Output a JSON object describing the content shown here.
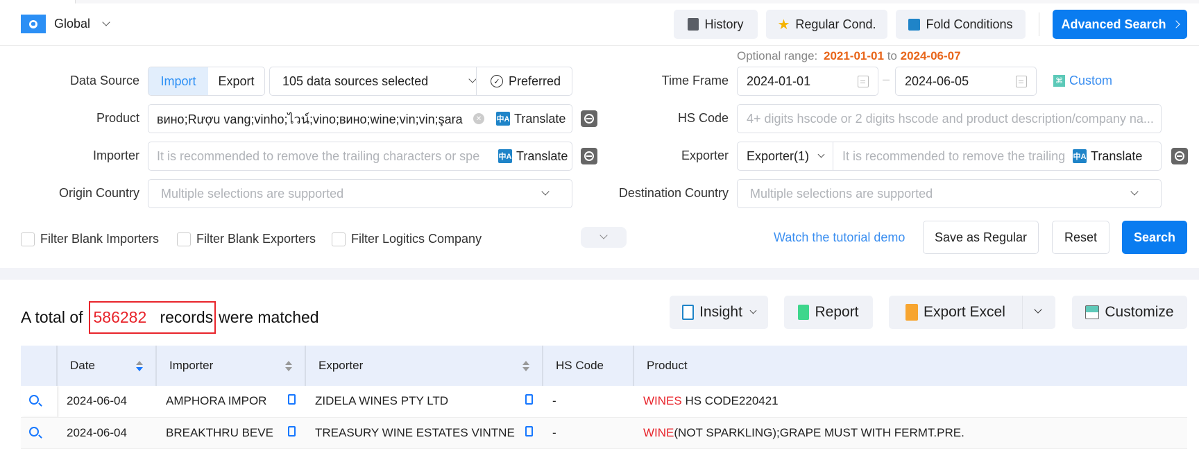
{
  "header": {
    "region": "Global",
    "buttons": {
      "history": "History",
      "regular_cond": "Regular Cond.",
      "fold_conditions": "Fold Conditions",
      "advanced_search": "Advanced Search"
    }
  },
  "form": {
    "data_source": {
      "label": "Data Source",
      "tabs": [
        "Import",
        "Export"
      ],
      "active_tab": "Import",
      "sources_selected": "105 data sources selected",
      "preferred": "Preferred"
    },
    "product": {
      "label": "Product",
      "value": "вино;Rượu vang;vinho;ไวน์;vino;вино;wine;vin;vin;şara",
      "translate": "Translate"
    },
    "importer": {
      "label": "Importer",
      "placeholder": "It is recommended to remove the trailing characters or spe",
      "translate": "Translate"
    },
    "origin_country": {
      "label": "Origin Country",
      "placeholder": "Multiple selections are supported"
    },
    "optional_range": {
      "label": "Optional range:",
      "from": "2021-01-01",
      "to_word": "to",
      "to": "2024-06-07"
    },
    "time_frame": {
      "label": "Time Frame",
      "start": "2024-01-01",
      "end": "2024-06-05",
      "separator": "–",
      "custom": "Custom"
    },
    "hs_code": {
      "label": "HS Code",
      "placeholder": "4+ digits hscode or 2 digits hscode and product description/company na..."
    },
    "exporter": {
      "label": "Exporter",
      "select": "Exporter(1)",
      "placeholder": "It is recommended to remove the trailing",
      "translate": "Translate"
    },
    "destination_country": {
      "label": "Destination Country",
      "placeholder": "Multiple selections are supported"
    },
    "filters": [
      "Filter Blank Importers",
      "Filter Blank Exporters",
      "Filter Logitics Company"
    ],
    "tutorial_link": "Watch the tutorial demo",
    "save_regular": "Save as Regular",
    "reset": "Reset",
    "search": "Search"
  },
  "results": {
    "prefix": "A total of",
    "count": "586282",
    "records": "records",
    "suffix": "were matched",
    "toolbar": {
      "insight": "Insight",
      "report": "Report",
      "export_excel": "Export Excel",
      "customize": "Customize"
    },
    "columns": [
      "Date",
      "Importer",
      "Exporter",
      "HS Code",
      "Product"
    ],
    "rows": [
      {
        "date": "2024-06-04",
        "importer": "AMPHORA IMPOR",
        "exporter": "ZIDELA WINES PTY LTD",
        "hs_code": "-",
        "product_highlight": "WINES",
        "product_rest": " HS CODE220421"
      },
      {
        "date": "2024-06-04",
        "importer": "BREAKTHRU BEVE",
        "exporter": "TREASURY WINE ESTATES VINTNE",
        "hs_code": "-",
        "product_highlight": "WINE",
        "product_rest": "(NOT SPARKLING);GRAPE MUST WITH FERMT.PRE."
      }
    ]
  },
  "colors": {
    "primary": "#0a7cf0",
    "highlight_red": "#e8242b",
    "orange": "#e8661b",
    "link_blue": "#3a8ef0"
  }
}
